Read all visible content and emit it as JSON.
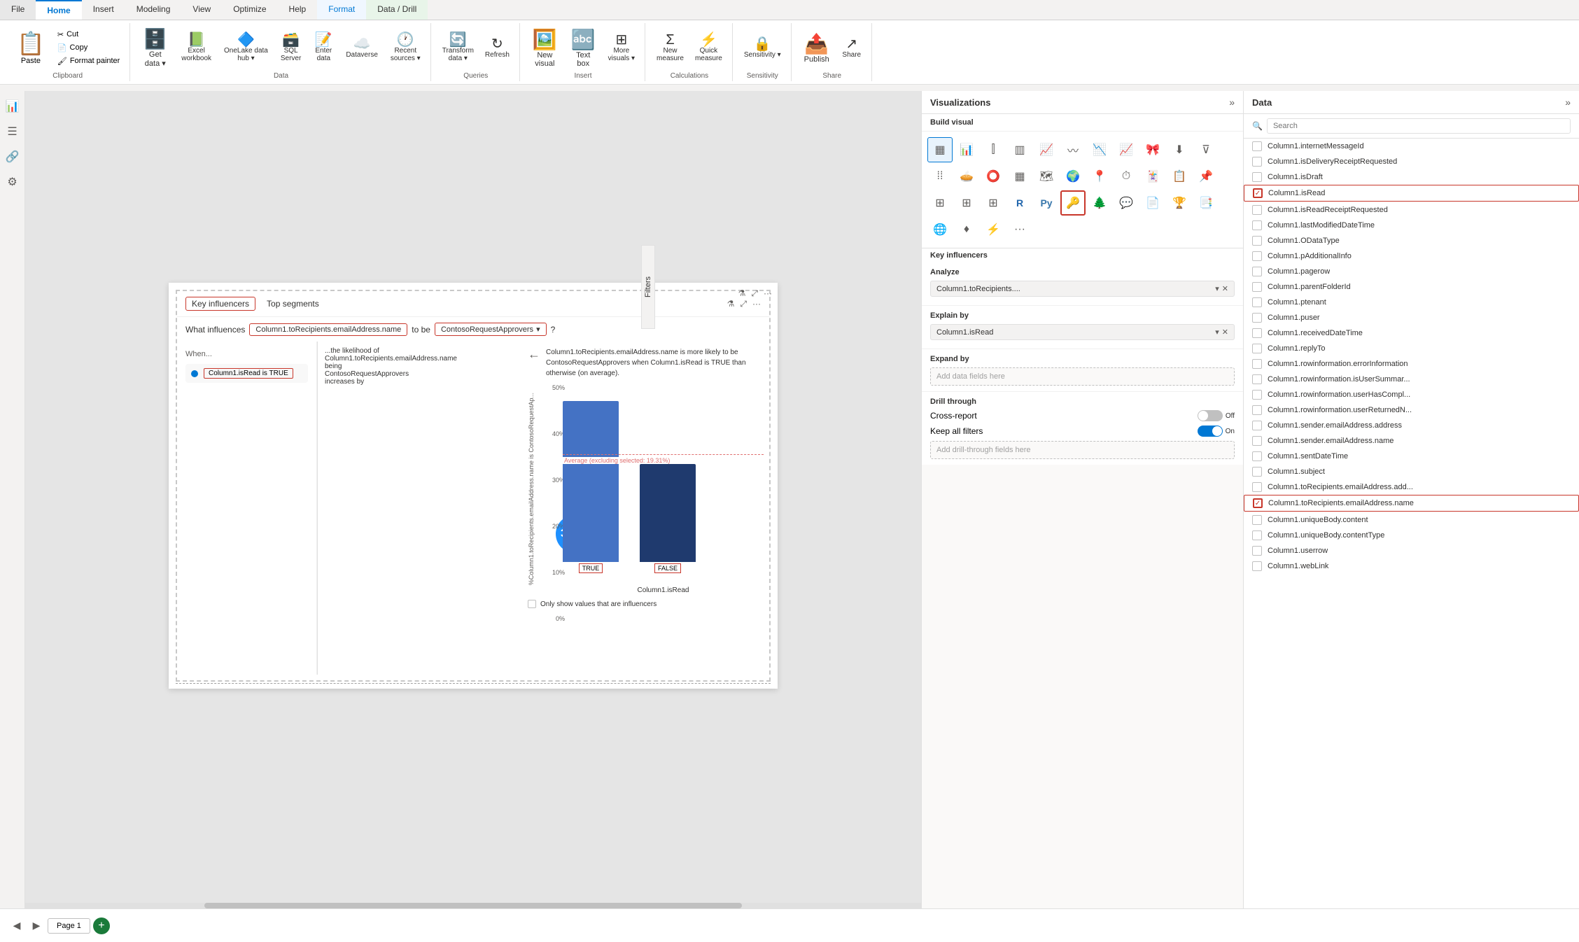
{
  "app": {
    "title": "Power BI Desktop"
  },
  "ribbon": {
    "tabs": [
      {
        "id": "file",
        "label": "File",
        "active": false
      },
      {
        "id": "home",
        "label": "Home",
        "active": true
      },
      {
        "id": "insert",
        "label": "Insert",
        "active": false
      },
      {
        "id": "modeling",
        "label": "Modeling",
        "active": false
      },
      {
        "id": "view",
        "label": "View",
        "active": false
      },
      {
        "id": "optimize",
        "label": "Optimize",
        "active": false
      },
      {
        "id": "help",
        "label": "Help",
        "active": false
      },
      {
        "id": "format",
        "label": "Format",
        "active": false,
        "highlight": true
      },
      {
        "id": "data_drill",
        "label": "Data / Drill",
        "active": false,
        "highlight2": true
      }
    ],
    "groups": {
      "clipboard": {
        "label": "Clipboard",
        "paste": "Paste",
        "cut": "✂ Cut",
        "copy": "📋 Copy",
        "format_painter": "🖌 Format painter"
      },
      "data": {
        "label": "Data",
        "get_data": "Get data",
        "excel_workbook": "Excel workbook",
        "onelake": "OneLake data hub",
        "sql": "SQL Server",
        "enter_data": "Enter data",
        "dataverse": "Dataverse",
        "recent_sources": "Recent sources"
      },
      "queries": {
        "label": "Queries",
        "transform": "Transform data",
        "refresh": "Refresh"
      },
      "insert": {
        "label": "Insert",
        "new_visual": "New visual",
        "text_box": "Text box",
        "more_visuals": "More visuals"
      },
      "calculations": {
        "label": "Calculations",
        "new_measure": "New measure",
        "quick_measure": "Quick measure"
      },
      "sensitivity": {
        "label": "Sensitivity",
        "sensitivity": "Sensitivity"
      },
      "share": {
        "label": "Share",
        "publish": "Publish",
        "share": "Share"
      }
    }
  },
  "visual": {
    "tabs": {
      "key_influencers": "Key influencers",
      "top_segments": "Top segments"
    },
    "question_prefix": "What influences",
    "question_column": "Column1.toRecipients.emailAddress.name",
    "question_to_be": "to be",
    "question_value": "ContosoRequestApprovers",
    "when_label": "When...",
    "likelihood_text": "...the likelihood of Column1.toRecipients.emailAddress.name being ContosoRequestApprovers increases by",
    "description": "Column1.toRecipients.emailAddress.name is more likely to be ContosoRequestApprovers when Column1.isRead is TRUE than otherwise (on average).",
    "influencer": {
      "label": "Column1.isRead is TRUE",
      "bubble_value": "3.54x"
    },
    "chart": {
      "title_y": "%Column1.toRecipients.emailAddress.name is ContosoRequestAp...",
      "x_title": "Column1.isRead",
      "bars": [
        {
          "label": "TRUE",
          "height_pct": 85,
          "color": "#4472c4"
        },
        {
          "label": "FALSE",
          "height_pct": 53,
          "color": "#1f3a6e"
        }
      ],
      "avg_label": "Average (excluding selected: 19.31%)",
      "y_labels": [
        "50%",
        "40%",
        "30%",
        "20%",
        "10%",
        "0%"
      ],
      "only_influencers_label": "Only show values that are influencers"
    }
  },
  "visualizations_panel": {
    "title": "Visualizations",
    "build_visual": "Build visual",
    "analyze_label": "Analyze",
    "analyze_field": "Column1.toRecipients....",
    "explain_by_label": "Explain by",
    "explain_field": "Column1.isRead",
    "expand_by_label": "Expand by",
    "expand_placeholder": "Add data fields here",
    "drill_through_label": "Drill through",
    "cross_report_label": "Cross-report",
    "cross_report_state": "Off",
    "keep_filters_label": "Keep all filters",
    "keep_filters_state": "On",
    "drill_placeholder": "Add drill-through fields here",
    "key_influencers_label": "Key influencers",
    "selected_viz_label": "Key influencers icon"
  },
  "data_panel": {
    "title": "Data",
    "search_placeholder": "Search",
    "items": [
      {
        "id": "internetMessageId",
        "label": "Column1.internetMessageId",
        "checked": false
      },
      {
        "id": "isDeliveryReceiptRequested",
        "label": "Column1.isDeliveryReceiptRequested",
        "checked": false
      },
      {
        "id": "isDraft",
        "label": "Column1.isDraft",
        "checked": false
      },
      {
        "id": "isRead",
        "label": "Column1.isRead",
        "checked": true,
        "highlighted": true
      },
      {
        "id": "isReadReceiptRequested",
        "label": "Column1.isReadReceiptRequested",
        "checked": false
      },
      {
        "id": "lastModifiedDateTime",
        "label": "Column1.lastModifiedDateTime",
        "checked": false
      },
      {
        "id": "oDataType",
        "label": "Column1.ODataType",
        "checked": false
      },
      {
        "id": "pAdditionalInfo",
        "label": "Column1.pAdditionalInfo",
        "checked": false
      },
      {
        "id": "pagerow",
        "label": "Column1.pagerow",
        "checked": false
      },
      {
        "id": "parentFolderId",
        "label": "Column1.parentFolderId",
        "checked": false
      },
      {
        "id": "ptenant",
        "label": "Column1.ptenant",
        "checked": false
      },
      {
        "id": "puser",
        "label": "Column1.puser",
        "checked": false
      },
      {
        "id": "receivedDateTime",
        "label": "Column1.receivedDateTime",
        "checked": false
      },
      {
        "id": "replyTo",
        "label": "Column1.replyTo",
        "checked": false
      },
      {
        "id": "rowInfoError",
        "label": "Column1.rowinformation.errorInformation",
        "checked": false
      },
      {
        "id": "rowInfoUserSummar",
        "label": "Column1.rowinformation.isUserSummar...",
        "checked": false
      },
      {
        "id": "rowInfoUserHasCompl",
        "label": "Column1.rowinformation.userHasCompl...",
        "checked": false
      },
      {
        "id": "rowInfoUserReturnedN",
        "label": "Column1.rowinformation.userReturnedN...",
        "checked": false
      },
      {
        "id": "senderEmailAddress",
        "label": "Column1.sender.emailAddress.address",
        "checked": false
      },
      {
        "id": "senderEmailAddressName",
        "label": "Column1.sender.emailAddress.name",
        "checked": false
      },
      {
        "id": "sentDateTime",
        "label": "Column1.sentDateTime",
        "checked": false
      },
      {
        "id": "subject",
        "label": "Column1.subject",
        "checked": false
      },
      {
        "id": "toRecipientsEmailAdd",
        "label": "Column1.toRecipients.emailAddress.add...",
        "checked": false
      },
      {
        "id": "toRecipientsEmailAddressName",
        "label": "Column1.toRecipients.emailAddress.name",
        "checked": true,
        "highlighted": true
      },
      {
        "id": "uniqueBodyContent",
        "label": "Column1.uniqueBody.content",
        "checked": false
      },
      {
        "id": "uniqueBodyContentType",
        "label": "Column1.uniqueBody.contentType",
        "checked": false
      },
      {
        "id": "userrow",
        "label": "Column1.userrow",
        "checked": false
      },
      {
        "id": "webLink",
        "label": "Column1.webLink",
        "checked": false
      }
    ]
  },
  "bottom_bar": {
    "page_label": "Page 1",
    "add_page_icon": "+"
  },
  "filters_tab": {
    "label": "Filters"
  }
}
